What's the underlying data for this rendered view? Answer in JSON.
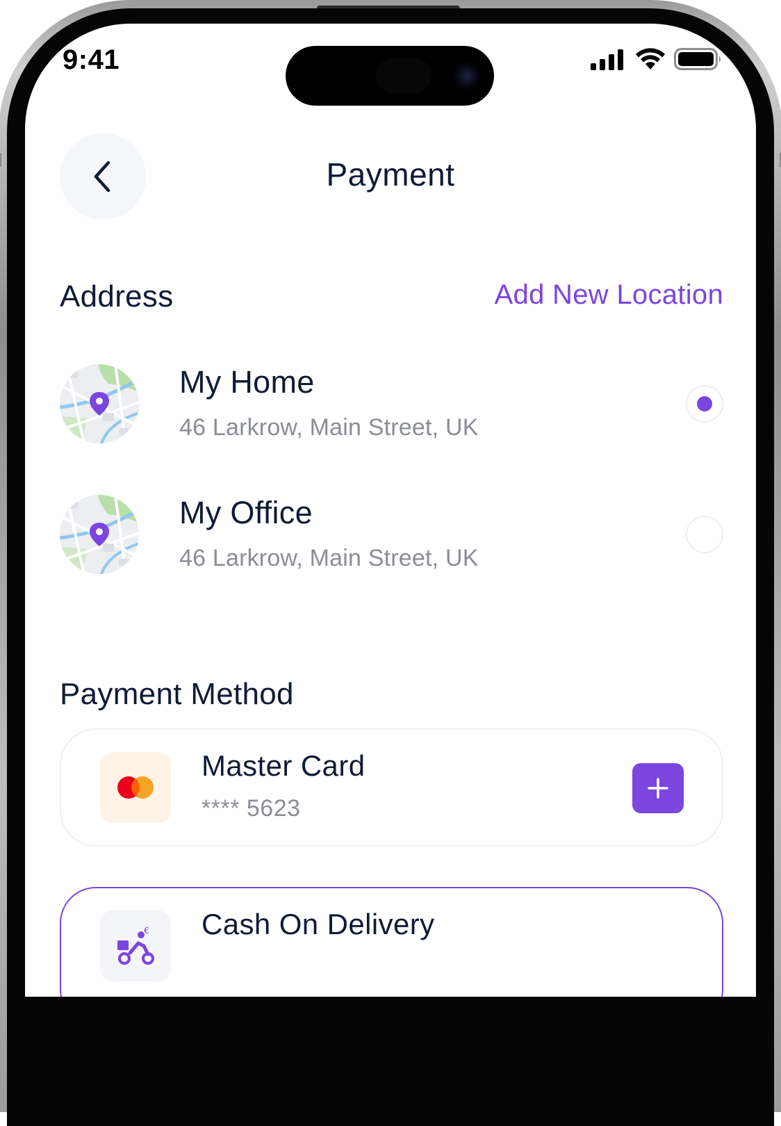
{
  "status_bar": {
    "time": "9:41"
  },
  "header": {
    "title": "Payment"
  },
  "address": {
    "section_title": "Address",
    "add_link": "Add New Location",
    "items": [
      {
        "name": "My Home",
        "line": "46 Larkrow, Main Street, UK",
        "selected": true
      },
      {
        "name": "My Office",
        "line": "46 Larkrow, Main Street, UK",
        "selected": false
      }
    ]
  },
  "payment": {
    "section_title": "Payment Method",
    "methods": [
      {
        "name": "Master Card",
        "detail": "**** 5623",
        "icon": "mastercard-icon"
      },
      {
        "name": "Cash On Delivery",
        "icon": "delivery-scooter-icon",
        "selected": true
      }
    ]
  },
  "colors": {
    "accent": "#7b45e0",
    "text_primary": "#0f1b35",
    "text_secondary": "#8b8d95",
    "mastercard_red": "#eb001b",
    "mastercard_orange": "#f79e1b"
  }
}
